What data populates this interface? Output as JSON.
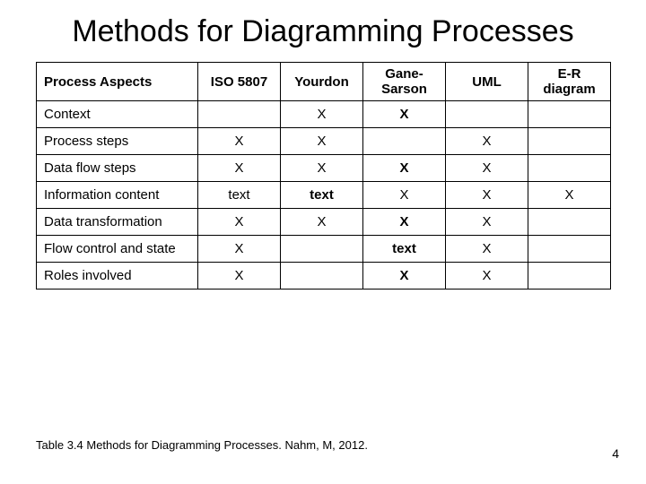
{
  "title": "Methods for Diagramming Processes",
  "caption": "Table 3.4  Methods for Diagramming Processes.   Nahm, M, 2012.",
  "page_number": "4",
  "chart_data": {
    "type": "table",
    "title": "Methods for Diagramming Processes",
    "columns": [
      "Process Aspects",
      "ISO 5807",
      "Yourdon",
      "Gane-Sarson",
      "UML",
      "E-R diagram"
    ],
    "rows": [
      {
        "aspect": "Context",
        "cells": [
          {
            "v": "",
            "b": false
          },
          {
            "v": "X",
            "b": false
          },
          {
            "v": "X",
            "b": true
          },
          {
            "v": "",
            "b": false
          },
          {
            "v": "",
            "b": false
          }
        ]
      },
      {
        "aspect": "Process steps",
        "cells": [
          {
            "v": "X",
            "b": false
          },
          {
            "v": "X",
            "b": false
          },
          {
            "v": "",
            "b": false
          },
          {
            "v": "X",
            "b": false
          },
          {
            "v": "",
            "b": false
          }
        ]
      },
      {
        "aspect": "Data flow steps",
        "cells": [
          {
            "v": "X",
            "b": false
          },
          {
            "v": "X",
            "b": false
          },
          {
            "v": "X",
            "b": true
          },
          {
            "v": "X",
            "b": false
          },
          {
            "v": "",
            "b": false
          }
        ]
      },
      {
        "aspect": "Information content",
        "cells": [
          {
            "v": "text",
            "b": false
          },
          {
            "v": "text",
            "b": true
          },
          {
            "v": "X",
            "b": false
          },
          {
            "v": "X",
            "b": false
          },
          {
            "v": "X",
            "b": false
          }
        ]
      },
      {
        "aspect": "Data transformation",
        "cells": [
          {
            "v": "X",
            "b": false
          },
          {
            "v": "X",
            "b": false
          },
          {
            "v": "X",
            "b": true
          },
          {
            "v": "X",
            "b": false
          },
          {
            "v": "",
            "b": false
          }
        ]
      },
      {
        "aspect": "Flow control and state",
        "cells": [
          {
            "v": "X",
            "b": false
          },
          {
            "v": "",
            "b": false
          },
          {
            "v": "text",
            "b": true
          },
          {
            "v": "X",
            "b": false
          },
          {
            "v": "",
            "b": false
          }
        ]
      },
      {
        "aspect": "Roles involved",
        "cells": [
          {
            "v": "X",
            "b": false
          },
          {
            "v": "",
            "b": false
          },
          {
            "v": "X",
            "b": true
          },
          {
            "v": "X",
            "b": false
          },
          {
            "v": "",
            "b": false
          }
        ]
      }
    ]
  }
}
